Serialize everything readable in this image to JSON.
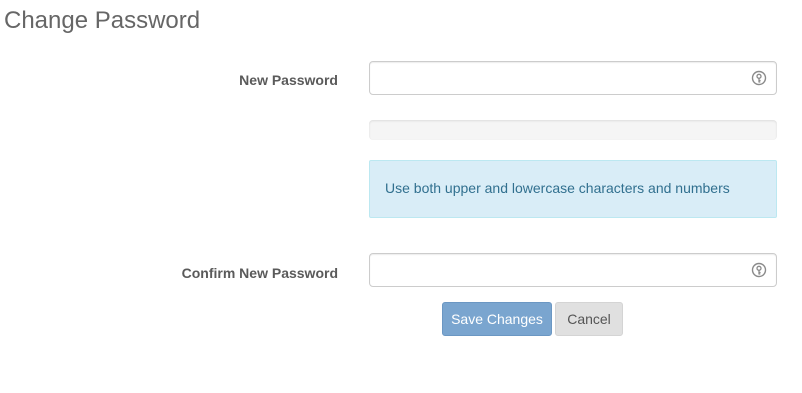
{
  "page": {
    "title": "Change Password"
  },
  "form": {
    "new_password": {
      "label": "New Password",
      "value": "",
      "placeholder": "",
      "icon": "key-icon"
    },
    "strength_meter": {
      "level_percent": 0
    },
    "hint": {
      "text": "Use both upper and lowercase characters and numbers"
    },
    "confirm_password": {
      "label": "Confirm New Password",
      "value": "",
      "placeholder": "",
      "icon": "key-icon"
    }
  },
  "actions": {
    "save_label": "Save Changes",
    "cancel_label": "Cancel"
  },
  "colors": {
    "primary_button": "#7aa5cf",
    "info_background": "#d9edf7",
    "info_text": "#31708f"
  }
}
